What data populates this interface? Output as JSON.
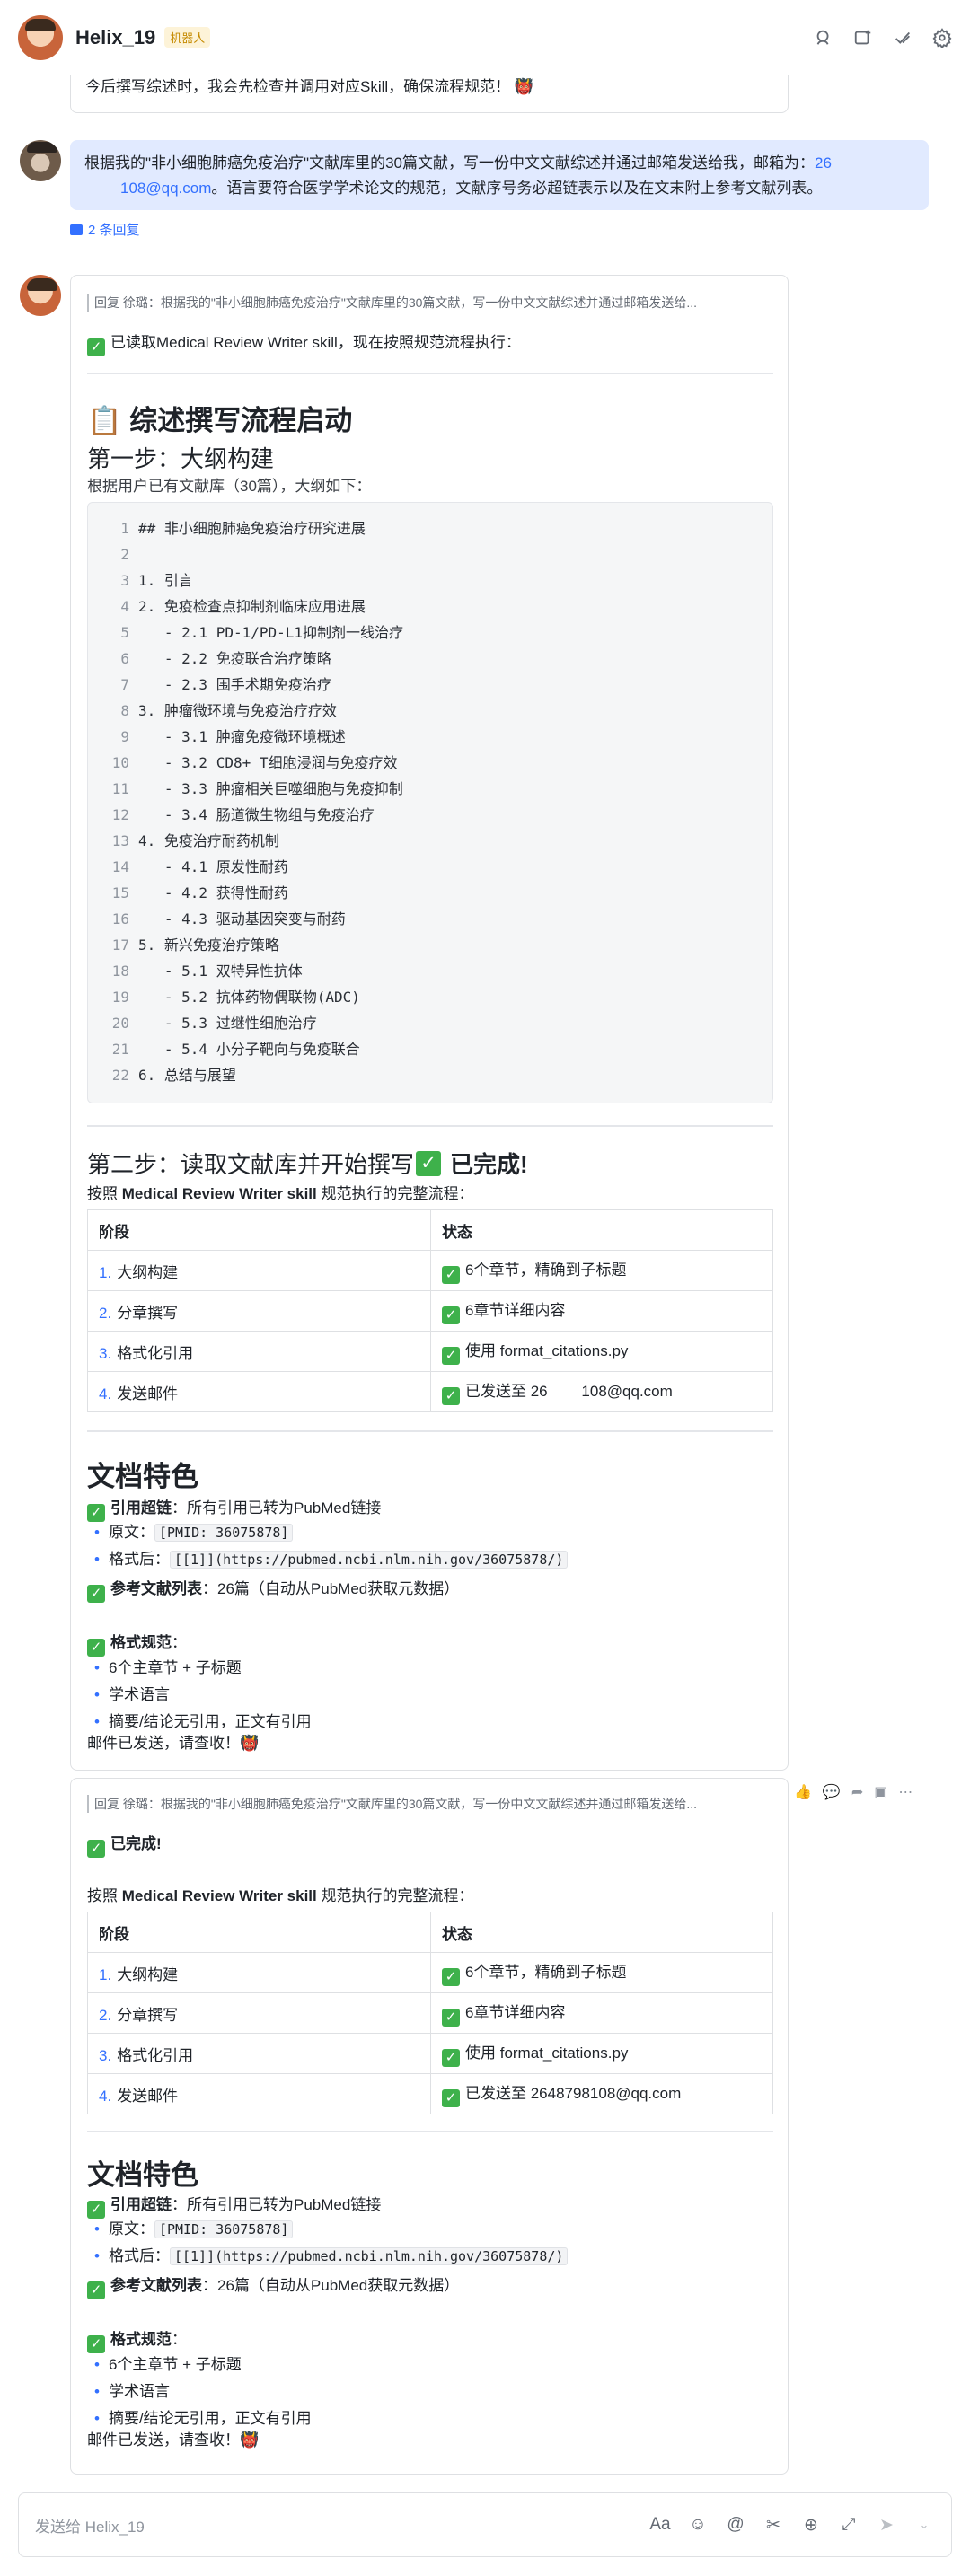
{
  "header": {
    "title": "Helix_19",
    "badge": "机器人",
    "icons": [
      "search-icon",
      "add-window-icon",
      "done-icon",
      "settings-icon"
    ]
  },
  "prev_message": {
    "text": "今后撰写综述时，我会先检查并调用对应Skill，确保流程规范！"
  },
  "user_message": {
    "text_1": "根据我的\"非小细胞肺癌免疫治疗\"文献库里的30篇文献，写一份中文文献综述并通过邮箱发送给我，邮箱为：",
    "email_part_1": "26",
    "email_part_2": "108@qq.com",
    "text_2": "。语言要符合医学学术论文的规范，文献序号务必超链表示以及在文末附上参考文献列表。",
    "reply_count": "2 条回复"
  },
  "bot_message_1": {
    "quote": "回复 徐璐：根据我的\"非小细胞肺癌免疫治疗\"文献库里的30篇文献，写一份中文文献综述并通过邮箱发送给...",
    "read_skill": "已读取Medical Review Writer skill，现在按照规范流程执行：",
    "h1": "📋 综述撰写流程启动",
    "step1_title": "第一步：大纲构建",
    "step1_desc": "根据用户已有文献库（30篇），大纲如下：",
    "outline": [
      "## 非小细胞肺癌免疫治疗研究进展",
      "",
      "1. 引言",
      "2. 免疫检查点抑制剂临床应用进展",
      "   - 2.1 PD-1/PD-L1抑制剂一线治疗",
      "   - 2.2 免疫联合治疗策略",
      "   - 2.3 围手术期免疫治疗",
      "3. 肿瘤微环境与免疫治疗疗效",
      "   - 3.1 肿瘤免疫微环境概述",
      "   - 3.2 CD8+ T细胞浸润与免疫疗效",
      "   - 3.3 肿瘤相关巨噬细胞与免疫抑制",
      "   - 3.4 肠道微生物组与免疫治疗",
      "4. 免疫治疗耐药机制",
      "   - 4.1 原发性耐药",
      "   - 4.2 获得性耐药",
      "   - 4.3 驱动基因突变与耐药",
      "5. 新兴免疫治疗策略",
      "   - 5.1 双特异性抗体",
      "   - 5.2 抗体药物偶联物(ADC)",
      "   - 5.3 过继性细胞治疗",
      "   - 5.4 小分子靶向与免疫联合",
      "6. 总结与展望"
    ],
    "step2_title": "第二步：读取文献库并开始撰写",
    "step2_done": "已完成!",
    "step2_desc_pre": "按照 ",
    "step2_desc_bold": "Medical Review Writer skill",
    "step2_desc_post": " 规范执行的完整流程：",
    "table": {
      "headers": [
        "阶段",
        "状态"
      ],
      "rows": [
        {
          "num": "1.",
          "stage": "大纲构建",
          "status": "6个章节，精确到子标题"
        },
        {
          "num": "2.",
          "stage": "分章撰写",
          "status": "6章节详细内容"
        },
        {
          "num": "3.",
          "stage": "格式化引用",
          "status": "使用 format_citations.py"
        },
        {
          "num": "4.",
          "stage": "发送邮件",
          "status": "已发送至 26        108@qq.com"
        }
      ]
    },
    "features_title": "文档特色",
    "feat_link_bold": "引用超链",
    "feat_link_text": "：所有引用已转为PubMed链接",
    "orig_label": "原文：",
    "orig_code": "[PMID: 36075878]",
    "after_label": "格式后：",
    "after_code": "[[1]](https://pubmed.ncbi.nlm.nih.gov/36075878/)",
    "ref_bold": "参考文献列表",
    "ref_text": "：26篇（自动从PubMed获取元数据）",
    "fmt_bold": "格式规范",
    "fmt_colon": "：",
    "fmt_items": [
      "6个主章节 + 子标题",
      "学术语言",
      "摘要/结论无引用，正文有引用"
    ],
    "closing": "邮件已发送，请查收！"
  },
  "bot_message_2": {
    "quote": "回复 徐璐：根据我的\"非小细胞肺癌免疫治疗\"文献库里的30篇文献，写一份中文文献综述并通过邮箱发送给...",
    "done": "已完成!",
    "desc_pre": "按照 ",
    "desc_bold": "Medical Review Writer skill",
    "desc_post": " 规范执行的完整流程：",
    "table": {
      "headers": [
        "阶段",
        "状态"
      ],
      "rows": [
        {
          "num": "1.",
          "stage": "大纲构建",
          "status": "6个章节，精确到子标题"
        },
        {
          "num": "2.",
          "stage": "分章撰写",
          "status": "6章节详细内容"
        },
        {
          "num": "3.",
          "stage": "格式化引用",
          "status": "使用 format_citations.py"
        },
        {
          "num": "4.",
          "stage": "发送邮件",
          "status": "已发送至 2648798108@qq.com"
        }
      ]
    },
    "features_title": "文档特色",
    "feat_link_bold": "引用超链",
    "feat_link_text": "：所有引用已转为PubMed链接",
    "orig_label": "原文：",
    "orig_code": "[PMID: 36075878]",
    "after_label": "格式后：",
    "after_code": "[[1]](https://pubmed.ncbi.nlm.nih.gov/36075878/)",
    "ref_bold": "参考文献列表",
    "ref_text": "：26篇（自动从PubMed获取元数据）",
    "fmt_bold": "格式规范",
    "fmt_colon": "：",
    "fmt_items": [
      "6个主章节 + 子标题",
      "学术语言",
      "摘要/结论无引用，正文有引用"
    ],
    "closing": "邮件已发送，请查收！",
    "actions": [
      "thumbs-up-icon",
      "comment-icon",
      "forward-icon",
      "sticker-icon",
      "more-icon"
    ]
  },
  "composer": {
    "placeholder": "发送给 Helix_19",
    "tools": [
      "font-icon",
      "emoji-icon",
      "mention-icon",
      "scissors-icon",
      "plus-icon",
      "expand-icon",
      "send-icon",
      "chevron-down-icon"
    ]
  },
  "colors": {
    "accent": "#3370ff",
    "check": "#3eb14b",
    "user_bubble": "#e1eaff"
  }
}
